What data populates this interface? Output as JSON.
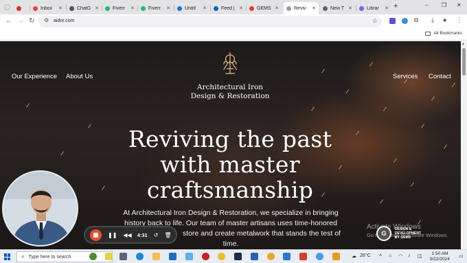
{
  "browser": {
    "tabs": [
      {
        "label": "",
        "color": "#d93025"
      },
      {
        "label": "Inbox",
        "color": "#ea4335"
      },
      {
        "label": "ChatG",
        "color": "#555555"
      },
      {
        "label": "Fiverr",
        "color": "#1dbf73"
      },
      {
        "label": "Fiverr",
        "color": "#1dbf73"
      },
      {
        "label": "Untitl",
        "color": "#1a73e8"
      },
      {
        "label": "Feed |",
        "color": "#0a66c2"
      },
      {
        "label": "GEMS",
        "color": "#e23b2e"
      },
      {
        "label": "Reviv",
        "color": "#9aa0a6"
      },
      {
        "label": "New T",
        "color": "#5f6368"
      },
      {
        "label": "Librar",
        "color": "#7b61ff"
      }
    ],
    "active_tab_index": 8,
    "url": "aidnr.com",
    "bookmarks_label": "All Bookmarks"
  },
  "site": {
    "nav_left": [
      "Our Experience",
      "About Us"
    ],
    "nav_right": [
      "Services",
      "Contact"
    ],
    "logo_line1": "Architectural Iron",
    "logo_line2": "Design & Restoration",
    "hero_line1": "Reviving the past",
    "hero_line2": "with master",
    "hero_line3": "craftsmanship",
    "hero_p1": "At Architectural Iron Design & Restoration, we specialize in bringing",
    "hero_p2": "history back to life. Our team of master artisans uses time-honored",
    "hero_p3": "store and create metalwork that stands the test of",
    "hero_p4": "time."
  },
  "recorder": {
    "time": "4:31"
  },
  "watermark": {
    "activate_title": "Activate Windows",
    "activate_sub": "Go to Settings to activate Windows.",
    "gems_line1": "DESIGN &",
    "gems_line2": "DEVELOPMENT",
    "gems_line3": "BY GEMS"
  },
  "taskbar": {
    "search_placeholder": "Type here to search",
    "temperature": "26°C",
    "time": "1:50 AM",
    "date": "9/22/2024"
  }
}
